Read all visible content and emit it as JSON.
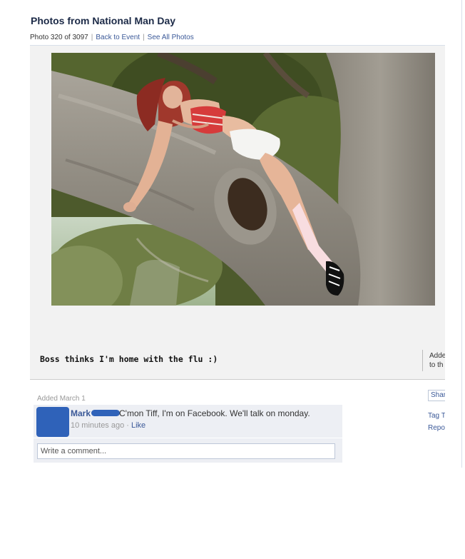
{
  "album": {
    "title": "Photos from National Man Day",
    "photo_counter": "Photo 320 of 3097",
    "back_link": "Back to Event",
    "all_photos_link": "See All Photos",
    "separator": "|"
  },
  "photo": {
    "caption": "Boss thinks I'm home with the flu :)"
  },
  "sidebar": {
    "added_to": [
      "Adde",
      "to th"
    ],
    "share_label": "Shar",
    "tag_label": "Tag T",
    "report_label": "Repo"
  },
  "meta": {
    "added_date": "Added March 1"
  },
  "comments": [
    {
      "author": "Mark",
      "text": "C'mon Tiff, I'm on Facebook. We'll talk on monday.",
      "time": "10 minutes ago",
      "dot": " · ",
      "like": "Like"
    }
  ],
  "comment_input": {
    "placeholder": "Write a comment..."
  },
  "colors": {
    "link": "#3b5998",
    "redaction": "#2f62b9",
    "stage_bg": "#f2f2f2",
    "comment_bg": "#edeff4"
  }
}
